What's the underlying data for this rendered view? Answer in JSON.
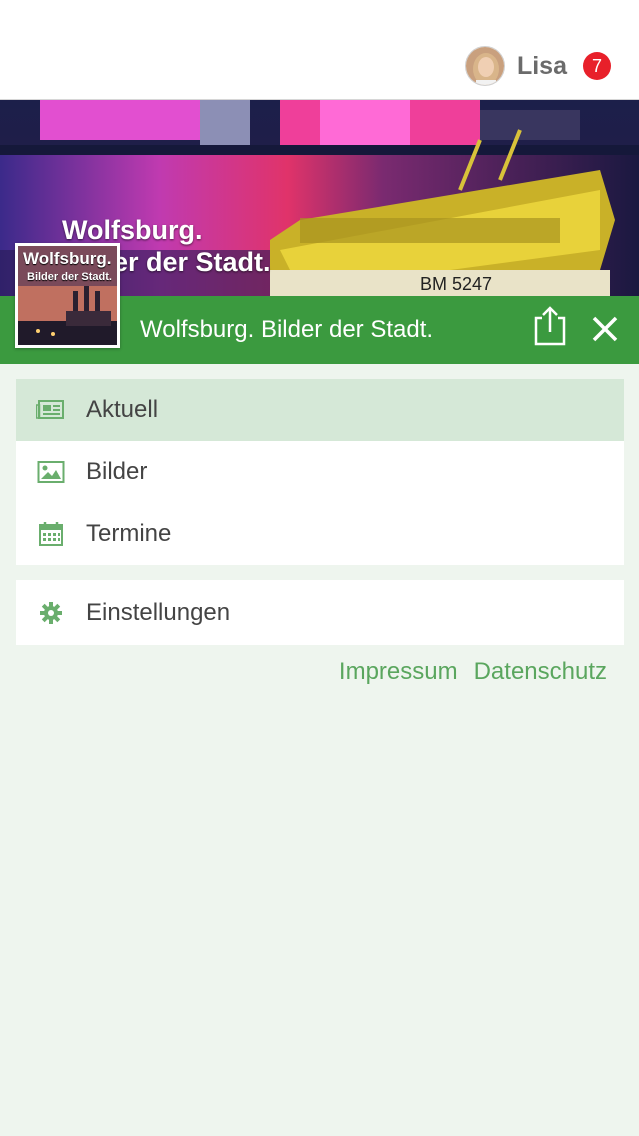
{
  "topbar": {
    "user_name": "Lisa",
    "notification_count": "7"
  },
  "hero": {
    "caption_line1": "Wolfsburg.",
    "caption_line2": "Bilder der Stadt.",
    "boat_label": "BM 5247"
  },
  "header": {
    "title": "Wolfsburg. Bilder der Stadt.",
    "thumb_line1": "Wolfsburg.",
    "thumb_line2": "Bilder der Stadt."
  },
  "menu": {
    "items": [
      {
        "label": "Aktuell",
        "icon": "newspaper-icon",
        "active": true
      },
      {
        "label": "Bilder",
        "icon": "image-icon",
        "active": false
      },
      {
        "label": "Termine",
        "icon": "calendar-icon",
        "active": false
      }
    ],
    "settings": {
      "label": "Einstellungen",
      "icon": "gear-icon"
    }
  },
  "footer": {
    "impressum": "Impressum",
    "datenschutz": "Datenschutz"
  },
  "colors": {
    "accent_green": "#3b9a3f",
    "active_row": "#d5e8d7",
    "badge_red": "#e8202a",
    "link_green": "#5aa65e",
    "page_bg": "#eef5ee"
  }
}
